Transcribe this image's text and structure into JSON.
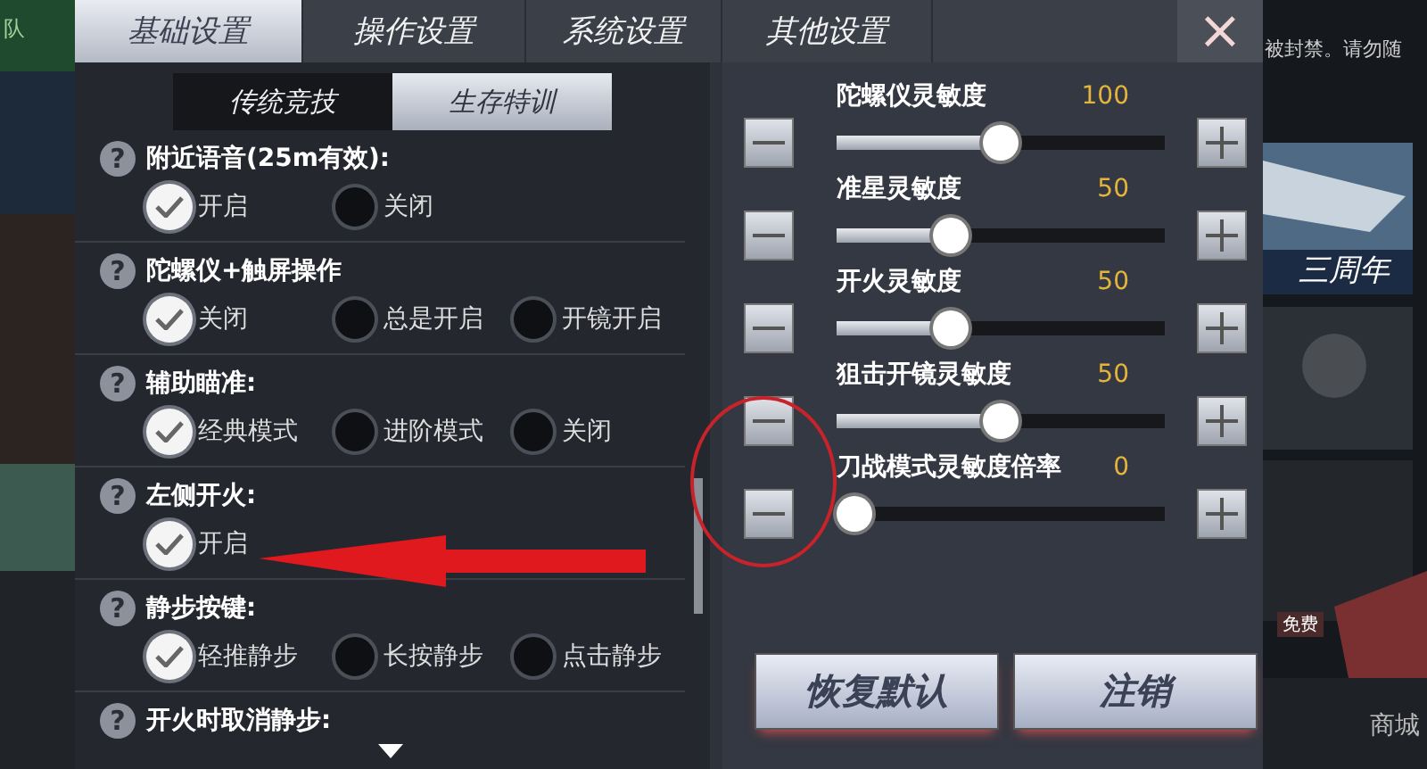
{
  "background": {
    "left_text": "队",
    "right_notice": "被封禁。请勿随",
    "anniversary_label": "三周年",
    "free_tag": "免费",
    "shop_label": "商城"
  },
  "tabs": [
    {
      "label": "基础设置",
      "selected": true
    },
    {
      "label": "操作设置",
      "selected": false
    },
    {
      "label": "系统设置",
      "selected": false
    },
    {
      "label": "其他设置",
      "selected": false
    }
  ],
  "close": "×",
  "mode_tabs": [
    {
      "label": "传统竞技",
      "selected": false
    },
    {
      "label": "生存特训",
      "selected": true
    }
  ],
  "settings": [
    {
      "help": "?",
      "title": "附近语音(25m有效):",
      "options": [
        {
          "label": "开启",
          "selected": true
        },
        {
          "label": "关闭",
          "selected": false
        }
      ]
    },
    {
      "help": "?",
      "title": "陀螺仪+触屏操作",
      "options": [
        {
          "label": "关闭",
          "selected": true
        },
        {
          "label": "总是开启",
          "selected": false
        },
        {
          "label": "开镜开启",
          "selected": false
        }
      ]
    },
    {
      "help": "?",
      "title": "辅助瞄准:",
      "options": [
        {
          "label": "经典模式",
          "selected": true
        },
        {
          "label": "进阶模式",
          "selected": false
        },
        {
          "label": "关闭",
          "selected": false
        }
      ]
    },
    {
      "help": "?",
      "title": "左侧开火:",
      "options": [
        {
          "label": "开启",
          "selected": true
        }
      ]
    },
    {
      "help": "?",
      "title": "静步按键:",
      "options": [
        {
          "label": "轻推静步",
          "selected": true
        },
        {
          "label": "长按静步",
          "selected": false
        },
        {
          "label": "点击静步",
          "selected": false
        }
      ]
    },
    {
      "help": "?",
      "title": "开火时取消静步:"
    }
  ],
  "sensitivity": [
    {
      "label": "陀螺仪灵敏度",
      "value": "100",
      "level": 0.5
    },
    {
      "label": "准星灵敏度",
      "value": "50",
      "level": 0.33
    },
    {
      "label": "开火灵敏度",
      "value": "50",
      "level": 0.33
    },
    {
      "label": "狙击开镜灵敏度",
      "value": "50",
      "level": 0.5
    },
    {
      "label": "刀战模式灵敏度倍率",
      "value": "0",
      "level": 0
    }
  ],
  "buttons": [
    "恢复默认",
    "注销"
  ]
}
